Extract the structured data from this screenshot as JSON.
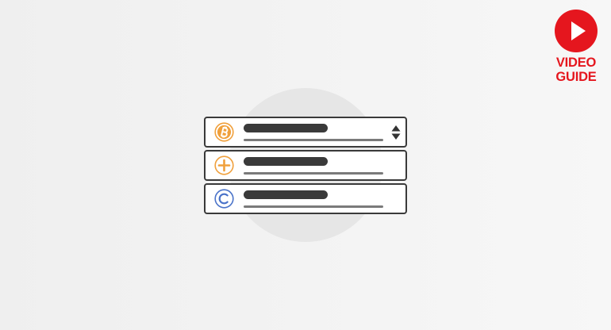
{
  "badge": {
    "line1": "VIDEO",
    "line2": "GUIDE",
    "icon": "play-icon",
    "color": "#e5161e"
  },
  "list": {
    "rows": [
      {
        "icon": "bitcoin-icon",
        "icon_color": "#f0a03c",
        "has_sort": true
      },
      {
        "icon": "plus-coin-icon",
        "icon_color": "#f0a03c",
        "has_sort": false
      },
      {
        "icon": "c-coin-icon",
        "icon_color": "#4a73c9",
        "has_sort": false
      }
    ]
  }
}
